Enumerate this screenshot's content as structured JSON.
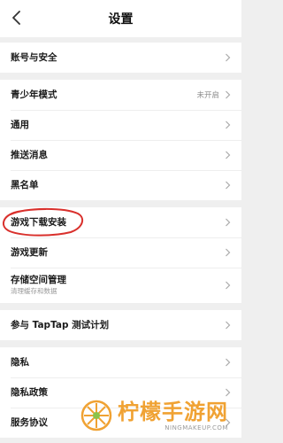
{
  "header": {
    "title": "设置"
  },
  "groups": [
    {
      "items": [
        {
          "label": "账号与安全"
        }
      ]
    },
    {
      "items": [
        {
          "label": "青少年模式",
          "value": "未开启"
        },
        {
          "label": "通用"
        },
        {
          "label": "推送消息"
        },
        {
          "label": "黑名单"
        }
      ]
    },
    {
      "items": [
        {
          "label": "游戏下载安装"
        },
        {
          "label": "游戏更新"
        },
        {
          "label": "存储空间管理",
          "subtitle": "清理缓存和数据"
        }
      ]
    },
    {
      "items": [
        {
          "label": "参与 TapTap 测试计划"
        }
      ]
    },
    {
      "items": [
        {
          "label": "隐私"
        },
        {
          "label": "隐私政策"
        },
        {
          "label": "服务协议"
        }
      ]
    }
  ],
  "watermark": {
    "text": "柠檬手游网",
    "url": "NINGMAKEUP.COM"
  },
  "colors": {
    "annotation": "#d9302c",
    "watermark": "#f0a233"
  },
  "icons": {
    "back": "back-arrow-icon",
    "chevron": "chevron-right-icon"
  }
}
